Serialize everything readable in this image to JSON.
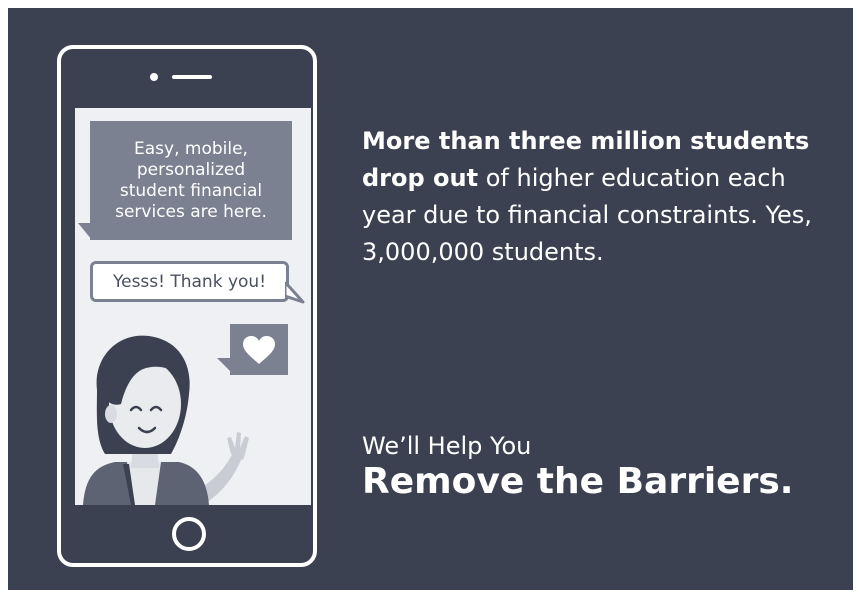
{
  "chat": {
    "incoming_lines": [
      "Easy, mobile,",
      "personalized",
      "student financial",
      "services are here."
    ],
    "reply": "Yesss!  Thank you!"
  },
  "headline": {
    "bold_part_1": "More than three million students",
    "bold_part_2": "drop out",
    "regular_part": " of higher education each year due to financial constraints. Yes, 3,000,000 students."
  },
  "tagline": {
    "line1": "We’ll Help You",
    "line2": "Remove the Barriers."
  },
  "colors": {
    "background": "#3b4150",
    "bubble": "#7b8190",
    "screen": "#eef0f3",
    "text": "#ffffff"
  },
  "icons": [
    "heart-icon",
    "home-button-icon"
  ]
}
